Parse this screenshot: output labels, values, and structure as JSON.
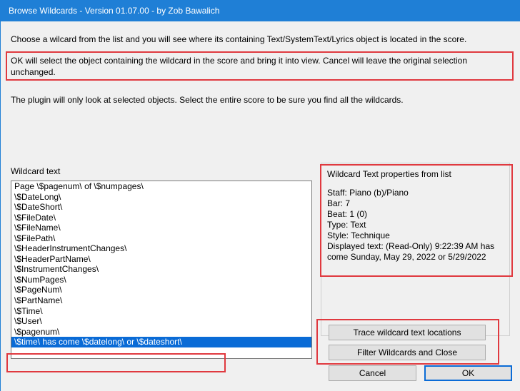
{
  "window": {
    "title": "Browse Wildcards - Version 01.07.00 - by Zob Bawalich"
  },
  "messages": {
    "intro": "Choose a wilcard from the list and you will see where its containing Text/SystemText/Lyrics object is located in the score.",
    "ok_info": "OK will select the object containing the wildcard in the score and bring it into view. Cancel will leave the original selection unchanged.",
    "selection_info": "The plugin will only look at selected objects. Select the entire score to be sure you find all the wildcards."
  },
  "list": {
    "label": "Wildcard text",
    "items": [
      "Page \\$pagenum\\ of \\$numpages\\",
      "\\$DateLong\\",
      "\\$DateShort\\",
      "\\$FileDate\\",
      "\\$FileName\\",
      "\\$FilePath\\",
      "\\$HeaderInstrumentChanges\\",
      "\\$HeaderPartName\\",
      "\\$InstrumentChanges\\",
      "\\$NumPages\\",
      "\\$PageNum\\",
      "\\$PartName\\",
      "\\$Time\\",
      "\\$User\\",
      "\\$pagenum\\",
      "\\$time\\ has come \\$datelong\\ or \\$dateshort\\"
    ],
    "selected_index": 15
  },
  "properties": {
    "title": "Wildcard Text properties from list",
    "staff": "Staff: Piano (b)/Piano",
    "bar": "Bar: 7",
    "beat": "Beat: 1 (0)",
    "type": "Type: Text",
    "style": "Style: Technique",
    "displayed_line1": "Displayed text: (Read-Only) 9:22:39 AM has",
    "displayed_line2": "come Sunday, May 29, 2022 or 5/29/2022"
  },
  "buttons": {
    "trace": "Trace wildcard text locations",
    "filter": "Filter Wildcards and Close",
    "cancel": "Cancel",
    "ok": "OK"
  },
  "colors": {
    "titlebar": "#1f7fd6",
    "highlight_border": "#e0393f",
    "selection": "#0a6bd6"
  }
}
